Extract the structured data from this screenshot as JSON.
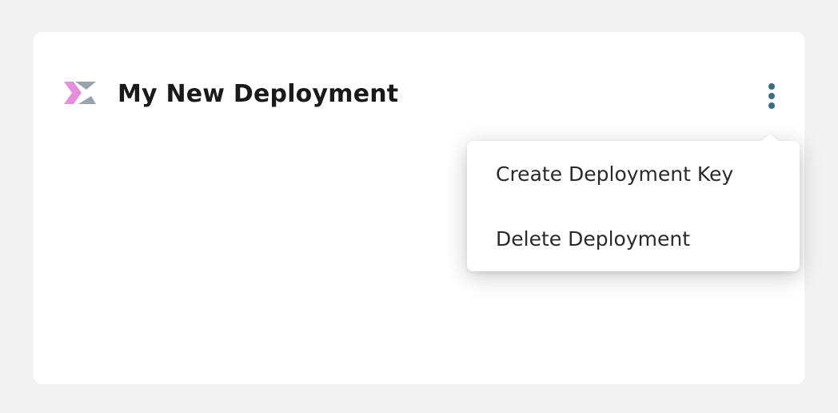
{
  "deployment": {
    "title": "My New Deployment",
    "logo_icon": "deployment-logo-icon",
    "menu_icon": "kebab-menu-icon"
  },
  "menu": {
    "items": [
      {
        "label": "Create Deployment Key"
      },
      {
        "label": "Delete Deployment"
      }
    ]
  },
  "colors": {
    "background": "#f2f2f2",
    "card": "#ffffff",
    "kebab": "#3c6f7d",
    "logo_pink": "#e08ad8",
    "logo_gray": "#9aa3ab",
    "text": "#1a1a1a"
  }
}
